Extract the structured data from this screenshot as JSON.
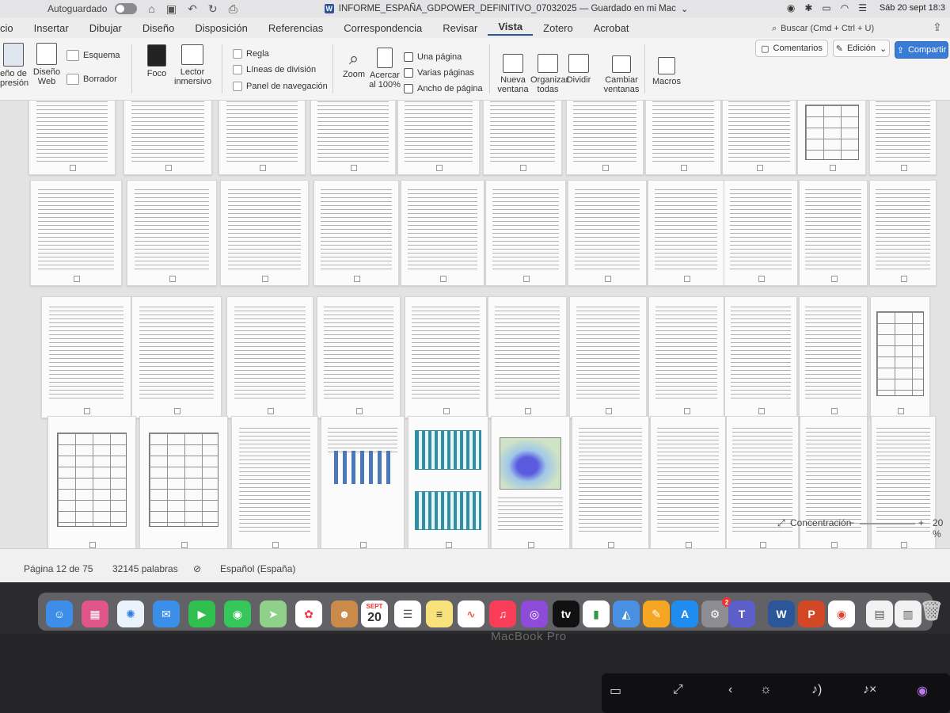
{
  "app": {
    "autosave_label": "Autoguardado",
    "doc_title": "INFORME_ESPAÑA_GDPOWER_DEFINITIVO_07032025 — Guardado en mi Mac",
    "clock": "Sáb 20 sept 18:3",
    "search_placeholder": "Buscar (Cmd + Ctrl + U)"
  },
  "tabs": [
    "cio",
    "Insertar",
    "Dibujar",
    "Diseño",
    "Disposición",
    "Referencias",
    "Correspondencia",
    "Revisar",
    "Vista",
    "Zotero",
    "Acrobat"
  ],
  "active_tab": "Vista",
  "ribbon": {
    "print_layout": "eño de\npresión",
    "web_layout": "Diseño\nWeb",
    "outline": "Esquema",
    "draft": "Borrador",
    "focus": "Foco",
    "immersive": "Lector\ninmersivo",
    "ruler": "Regla",
    "gridlines": "Líneas de división",
    "nav_pane": "Panel de navegación",
    "zoom": "Zoom",
    "zoom100": "Acercar\nal 100%",
    "one_page": "Una página",
    "multi_page": "Varias páginas",
    "page_width": "Ancho de página",
    "new_window": "Nueva\nventana",
    "arrange": "Organizar\ntodas",
    "split": "Dividir",
    "switch": "Cambiar\nventanas",
    "macros": "Macros",
    "comments_btn": "Comentarios",
    "editing_btn": "Edición",
    "share_btn": "Compartir"
  },
  "status": {
    "page": "Página 12 de 75",
    "words": "32145 palabras",
    "language": "Español (España)",
    "focus": "Concentración",
    "zoom": "20 %"
  },
  "dock": {
    "calendar_month": "SEPT",
    "calendar_day": "20",
    "tv_label": "tv",
    "badge": "2"
  },
  "hardware": {
    "brand": "MacBook Pro"
  }
}
